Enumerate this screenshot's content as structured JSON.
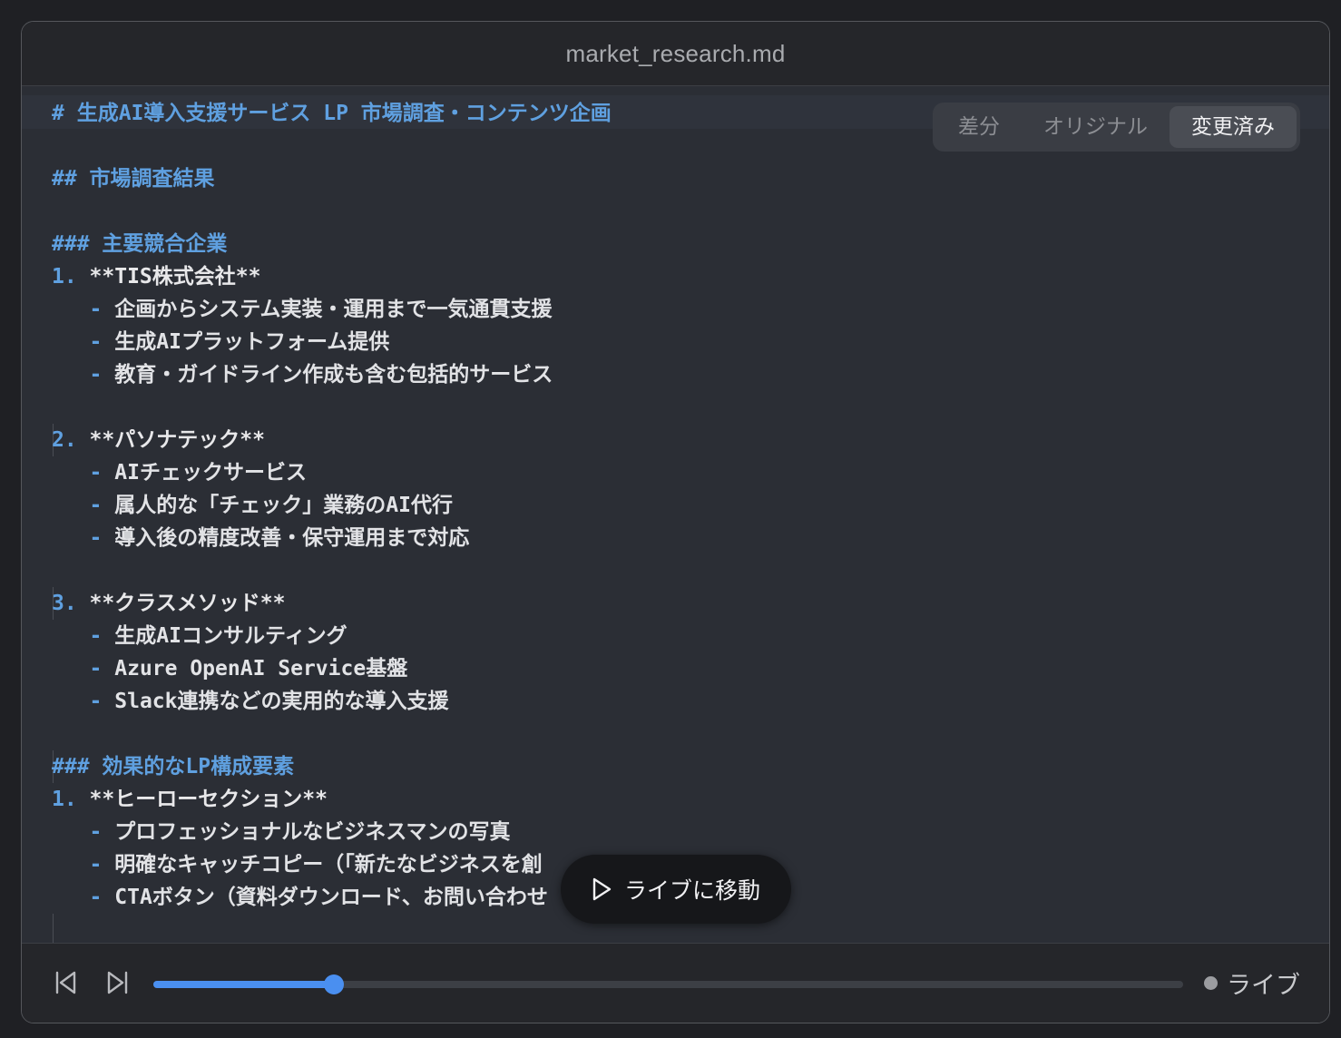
{
  "window": {
    "title": "market_research.md"
  },
  "view_toggle": {
    "options": [
      "差分",
      "オリジナル",
      "変更済み"
    ],
    "selected": "変更済み"
  },
  "document": {
    "lines": [
      {
        "parts": [
          {
            "cls": "h",
            "text": "# 生成AI導入支援サービス LP 市場調査・コンテンツ企画"
          }
        ]
      },
      {
        "parts": []
      },
      {
        "parts": [
          {
            "cls": "h",
            "text": "## 市場調査結果"
          }
        ]
      },
      {
        "parts": []
      },
      {
        "parts": [
          {
            "cls": "h",
            "text": "### 主要競合企業"
          }
        ]
      },
      {
        "parts": [
          {
            "cls": "num",
            "text": "1. "
          },
          {
            "cls": "strong",
            "text": "**TIS株式会社**"
          }
        ]
      },
      {
        "parts": [
          {
            "cls": "dash",
            "text": "   - "
          },
          {
            "cls": "txt",
            "text": "企画からシステム実装・運用まで一気通貫支援"
          }
        ]
      },
      {
        "parts": [
          {
            "cls": "dash",
            "text": "   - "
          },
          {
            "cls": "txt",
            "text": "生成AIプラットフォーム提供"
          }
        ]
      },
      {
        "parts": [
          {
            "cls": "dash",
            "text": "   - "
          },
          {
            "cls": "txt",
            "text": "教育・ガイドライン作成も含む包括的サービス"
          }
        ]
      },
      {
        "parts": []
      },
      {
        "parts": [
          {
            "cls": "num",
            "text": "2. "
          },
          {
            "cls": "strong",
            "text": "**パソナテック**"
          }
        ]
      },
      {
        "parts": [
          {
            "cls": "dash",
            "text": "   - "
          },
          {
            "cls": "txt",
            "text": "AIチェックサービス"
          }
        ]
      },
      {
        "parts": [
          {
            "cls": "dash",
            "text": "   - "
          },
          {
            "cls": "txt",
            "text": "属人的な「チェック」業務のAI代行"
          }
        ]
      },
      {
        "parts": [
          {
            "cls": "dash",
            "text": "   - "
          },
          {
            "cls": "txt",
            "text": "導入後の精度改善・保守運用まで対応"
          }
        ]
      },
      {
        "parts": []
      },
      {
        "parts": [
          {
            "cls": "num",
            "text": "3. "
          },
          {
            "cls": "strong",
            "text": "**クラスメソッド**"
          }
        ]
      },
      {
        "parts": [
          {
            "cls": "dash",
            "text": "   - "
          },
          {
            "cls": "txt",
            "text": "生成AIコンサルティング"
          }
        ]
      },
      {
        "parts": [
          {
            "cls": "dash",
            "text": "   - "
          },
          {
            "cls": "txt",
            "text": "Azure OpenAI Service基盤"
          }
        ]
      },
      {
        "parts": [
          {
            "cls": "dash",
            "text": "   - "
          },
          {
            "cls": "txt",
            "text": "Slack連携などの実用的な導入支援"
          }
        ]
      },
      {
        "parts": []
      },
      {
        "parts": [
          {
            "cls": "h",
            "text": "### 効果的なLP構成要素"
          }
        ]
      },
      {
        "parts": [
          {
            "cls": "num",
            "text": "1. "
          },
          {
            "cls": "strong",
            "text": "**ヒーローセクション**"
          }
        ]
      },
      {
        "parts": [
          {
            "cls": "dash",
            "text": "   - "
          },
          {
            "cls": "txt",
            "text": "プロフェッショナルなビジネスマンの写真"
          }
        ]
      },
      {
        "parts": [
          {
            "cls": "dash",
            "text": "   - "
          },
          {
            "cls": "txt",
            "text": "明確なキャッチコピー（「新たなビジネスを創"
          }
        ]
      },
      {
        "parts": [
          {
            "cls": "dash",
            "text": "   - "
          },
          {
            "cls": "txt",
            "text": "CTAボタン（資料ダウンロード、お問い合わせ"
          }
        ]
      },
      {
        "parts": []
      }
    ]
  },
  "overlay": {
    "go_live_label": "ライブに移動"
  },
  "playback": {
    "progress_fraction": 0.175,
    "live_label": "ライブ"
  },
  "icons": {
    "prev": "skip-back-icon",
    "next": "skip-forward-icon",
    "play": "play-icon"
  },
  "colors": {
    "accent": "#4a8ff0",
    "heading": "#5fa0e0",
    "background": "#2b2e35"
  }
}
